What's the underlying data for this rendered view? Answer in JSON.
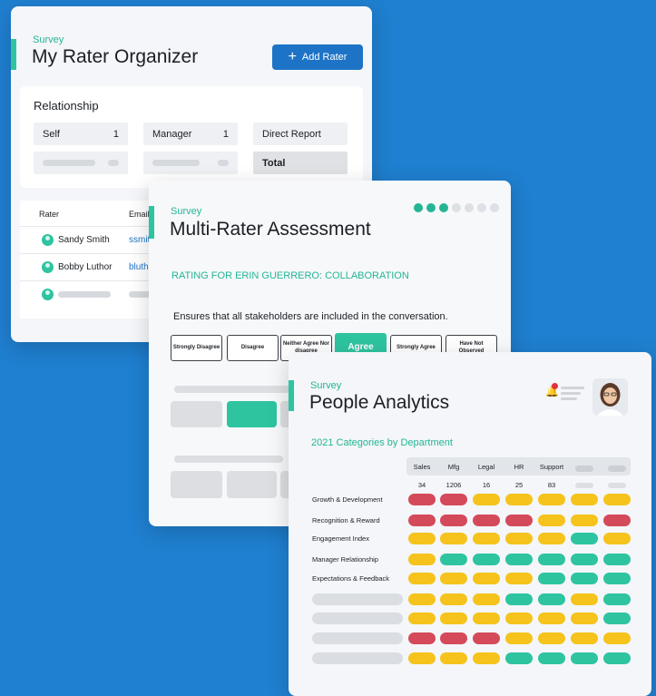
{
  "colors": {
    "background": "#1f7fd0",
    "accent": "#2ec4a0",
    "primary": "#1d74c6",
    "red": "#d44a5a",
    "yellow": "#f5c31c",
    "green": "#2ec4a0"
  },
  "rater_organizer": {
    "survey_label": "Survey",
    "title": "My Rater Organizer",
    "add_button": {
      "label": "Add Rater",
      "icon": "plus-icon"
    },
    "relationship": {
      "heading": "Relationship",
      "cells": [
        {
          "label": "Self",
          "count": "1"
        },
        {
          "label": "Manager",
          "count": "1"
        },
        {
          "label": "Direct Report",
          "count": ""
        },
        {
          "label": "Total",
          "count": ""
        }
      ]
    },
    "table": {
      "headers": [
        "Rater",
        "Email"
      ],
      "rows": [
        {
          "name": "Sandy Smith",
          "email": "ssmit"
        },
        {
          "name": "Bobby Luthor",
          "email": "bluth"
        }
      ]
    }
  },
  "assessment": {
    "survey_label": "Survey",
    "title": "Multi-Rater Assessment",
    "progress": {
      "completed_steps": 3,
      "total_steps": 7
    },
    "rating_for": "RATING FOR ERIN GUERRERO: COLLABORATION",
    "statement": "Ensures that all stakeholders are included in the conversation.",
    "options": [
      "Strongly Disagree",
      "Disagree",
      "Neither Agree Nor disagree",
      "Agree",
      "Strongly Agree",
      "Have Not Observed"
    ],
    "selected_option": "Agree"
  },
  "people_analytics": {
    "survey_label": "Survey",
    "title": "People Analytics",
    "categories_title": "2021 Categories by Department",
    "departments": [
      "Sales",
      "Mfg",
      "Legal",
      "HR",
      "Support"
    ],
    "counts": [
      "34",
      "1206",
      "16",
      "25",
      "83"
    ],
    "rows": [
      {
        "label": "Growth & Development",
        "cells": [
          "red",
          "red",
          "yellow",
          "yellow",
          "yellow",
          "yellow",
          "yellow"
        ]
      },
      {
        "label": "Recognition & Reward",
        "cells": [
          "red",
          "red",
          "red",
          "red",
          "yellow",
          "yellow",
          "red"
        ]
      },
      {
        "label": "Engagement Index",
        "cells": [
          "yellow",
          "yellow",
          "yellow",
          "yellow",
          "yellow",
          "green",
          "yellow"
        ]
      },
      {
        "label": "Manager Relationship",
        "cells": [
          "yellow",
          "green",
          "green",
          "green",
          "green",
          "green",
          "green"
        ]
      },
      {
        "label": "Expectations & Feedback",
        "cells": [
          "yellow",
          "yellow",
          "yellow",
          "yellow",
          "green",
          "green",
          "green"
        ]
      },
      {
        "label": "",
        "cells": [
          "yellow",
          "yellow",
          "yellow",
          "green",
          "green",
          "yellow",
          "green"
        ]
      },
      {
        "label": "",
        "cells": [
          "yellow",
          "yellow",
          "yellow",
          "yellow",
          "yellow",
          "yellow",
          "green"
        ]
      },
      {
        "label": "",
        "cells": [
          "red",
          "red",
          "red",
          "yellow",
          "yellow",
          "yellow",
          "yellow"
        ]
      },
      {
        "label": "",
        "cells": [
          "yellow",
          "yellow",
          "yellow",
          "green",
          "green",
          "green",
          "green"
        ]
      }
    ]
  }
}
